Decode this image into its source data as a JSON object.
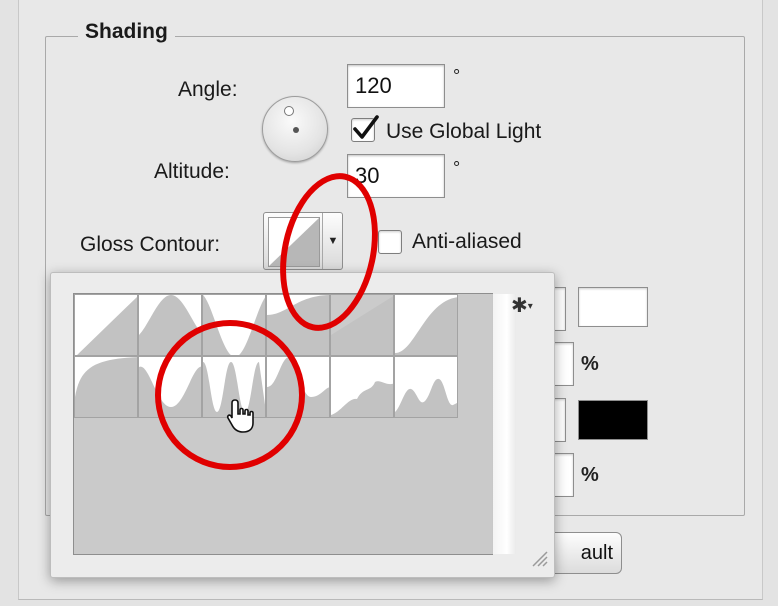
{
  "shading": {
    "title": "Shading",
    "angle_label": "Angle:",
    "angle_value": "120",
    "degree_symbol": "°",
    "use_global_light_label": "Use Global Light",
    "use_global_light_checked": true,
    "altitude_label": "Altitude:",
    "altitude_value": "30",
    "gloss_contour_label": "Gloss Contour:",
    "anti_aliased_label": "Anti-aliased",
    "anti_aliased_checked": false
  },
  "contour_picker": {
    "icons": [
      "gear-icon",
      "chevron-down-icon",
      "resize-grip-icon"
    ],
    "rows": 2,
    "columns": 6
  },
  "right_column": {
    "percent_1": "%",
    "percent_2": "%",
    "highlight_color": "#ffffff",
    "shadow_color": "#000000"
  },
  "bottom": {
    "button_partial_label": "ault"
  },
  "annotations": {
    "ring_color": "#e00000"
  },
  "cursor": "hand-pointer-icon"
}
